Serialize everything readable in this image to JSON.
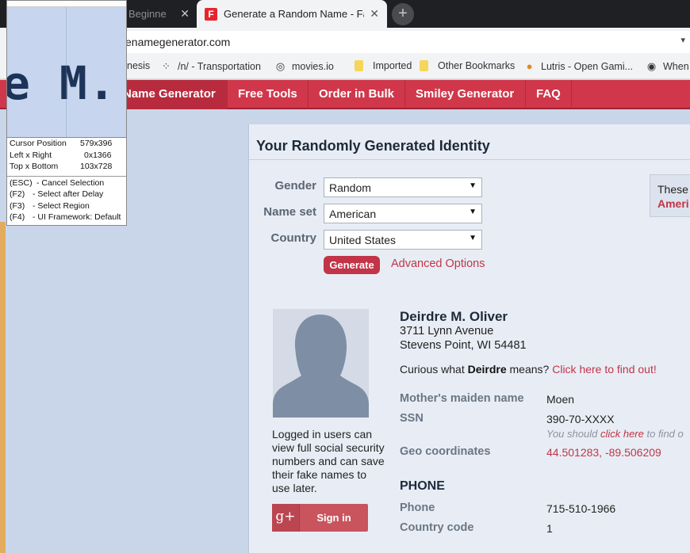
{
  "browser": {
    "tabs": [
      {
        "title": "Beginners",
        "active": false
      },
      {
        "title": "Generate a Random Name - Fake",
        "active": true,
        "favicon": "F"
      }
    ],
    "tab_close_glyph": "✕",
    "new_tab_glyph": "+",
    "url": "enamegenerator.com",
    "bookmarks": [
      {
        "label": "nesis",
        "icon": "none"
      },
      {
        "label": "/n/ - Transportation",
        "icon": "nodes-icon"
      },
      {
        "label": "movies.io",
        "icon": "film-reel-icon"
      },
      {
        "label": "Imported",
        "icon": "folder-icon"
      },
      {
        "label": "Other Bookmarks",
        "icon": "folder-icon"
      },
      {
        "label": "Lutris - Open Gami...",
        "icon": "lutris-icon"
      },
      {
        "label": "When",
        "icon": "globe-icon"
      }
    ]
  },
  "nav": {
    "items": [
      "Name Generator",
      "Free Tools",
      "Order in Bulk",
      "Smiley Generator",
      "FAQ"
    ]
  },
  "form": {
    "title": "Your Randomly Generated Identity",
    "gender_label": "Gender",
    "gender_value": "Random",
    "nameset_label": "Name set",
    "nameset_value": "American",
    "country_label": "Country",
    "country_value": "United States",
    "generate_label": "Generate",
    "advanced_label": "Advanced Options"
  },
  "side_box": {
    "line1": "These",
    "line2": "Ameri"
  },
  "identity": {
    "name": "Deirdre M. Oliver",
    "street": "3711 Lynn Avenue",
    "city": "Stevens Point, WI 54481",
    "curious_prefix": "Curious what ",
    "curious_name": "Deirdre",
    "curious_suffix": " means? ",
    "curious_link": "Click here to find out!",
    "login_text": "Logged in users can view full social security numbers and can save their fake names to use later.",
    "signin_label": "Sign in",
    "gplus_glyph": "g+",
    "fields": {
      "maiden_label": "Mother's maiden name",
      "maiden_value": "Moen",
      "ssn_label": "SSN",
      "ssn_value": "390-70-XXXX",
      "ssn_note_prefix": "You should ",
      "ssn_note_link": "click here",
      "ssn_note_suffix": " to find o",
      "geo_label": "Geo coordinates",
      "geo_value": "44.501283, -89.506209"
    },
    "phone_heading": "PHONE",
    "phone_label": "Phone",
    "phone_value": "715-510-1966",
    "country_code_label": "Country code",
    "country_code_value": "1"
  },
  "magnifier": {
    "zoom_text": "e M.",
    "cursor_label": "Cursor Position",
    "cursor_value": "579x396",
    "lr_label": "Left x Right",
    "lr_value": "0x1366",
    "tb_label": "Top x Bottom",
    "tb_value": "103x728",
    "shortcuts": [
      {
        "key": "(ESC)",
        "desc": "- Cancel Selection"
      },
      {
        "key": "(F2)",
        "desc": "- Select after Delay"
      },
      {
        "key": "(F3)",
        "desc": "- Select Region"
      },
      {
        "key": "(F4)",
        "desc": "- UI Framework: Default"
      }
    ]
  },
  "colors": {
    "brand_red": "#d0374a",
    "link_red": "#c23447"
  }
}
